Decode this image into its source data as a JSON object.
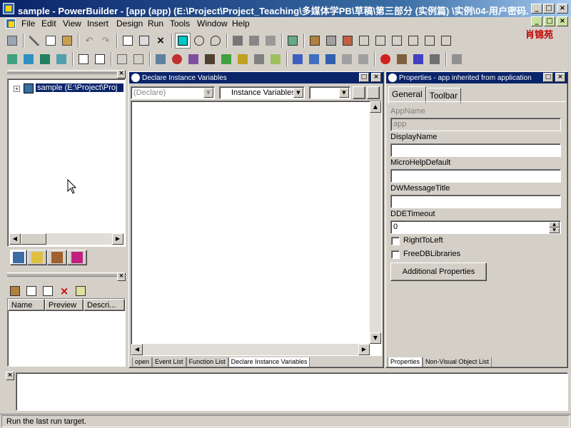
{
  "window": {
    "title": "sample - PowerBuilder - [app (app) (E:\\Project\\Project_Teaching\\多媒体学PB\\草稿\\第三部分 (实例篇) \\实例\\04-用户密码..."
  },
  "menu": [
    "File",
    "Edit",
    "View",
    "Insert",
    "Design",
    "Run",
    "Tools",
    "Window",
    "Help"
  ],
  "watermark": "肖锦苑",
  "tree": {
    "root_label": "sample (E:\\Project\\Proj"
  },
  "list_headers": [
    "Name",
    "Preview",
    "Descri..."
  ],
  "script_window": {
    "title": "Declare Instance Variables",
    "combo1": "(Declare)",
    "combo2": "Instance Variables",
    "tabs": [
      "open",
      "Event List",
      "Function List",
      "Declare Instance Variables"
    ]
  },
  "properties": {
    "title": "Properties - app inherited from application",
    "tabs": [
      "General",
      "Toolbar"
    ],
    "fields": {
      "appname_label": "AppName",
      "appname_value": "app",
      "displayname_label": "DisplayName",
      "microhelp_label": "MicroHelpDefault",
      "dwmessage_label": "DWMessageTitle",
      "ddetimeout_label": "DDETimeout",
      "ddetimeout_value": "0",
      "righttoleft_label": "RightToLeft",
      "freedblibraries_label": "FreeDBLibraries",
      "additional_button": "Additional Properties"
    },
    "bottom_tabs": [
      "Properties",
      "Non-Visual Object List"
    ]
  },
  "status": {
    "text": "Run the last run target."
  },
  "colors": {
    "titlebar": "#0a246a",
    "face": "#d4d0c8"
  }
}
